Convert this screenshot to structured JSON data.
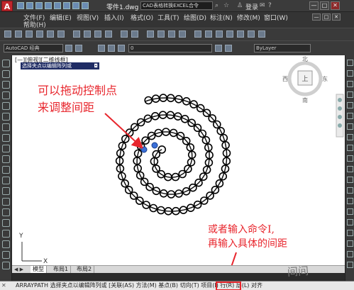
{
  "titlebar": {
    "logo": "A",
    "file_title": "零件1.dwg",
    "search_text": "CAD表格转换EXCEL合令",
    "login": "登录",
    "min_label": "—",
    "restore_label": "□",
    "close_label": "✕"
  },
  "menu": {
    "row1": [
      "文件(F)",
      "编辑(E)",
      "视图(V)",
      "插入(I)",
      "格式(O)",
      "工具(T)",
      "绘图(D)",
      "标注(N)",
      "修改(M)",
      "窗口(W)"
    ],
    "row2": [
      "帮助(H)"
    ]
  },
  "toolbar": {
    "workspace": "AutoCAD 经典",
    "layer": "0",
    "bylayer": "ByLayer"
  },
  "viewport": {
    "label": "[—][俯视][二维线框]",
    "tooltip": "选择夹点以编辑阵列或",
    "tooltip_mark": "◘"
  },
  "viewcube": {
    "north": "北",
    "south": "南",
    "east": "东",
    "west": "西",
    "top": "上",
    "wcs": "WCS"
  },
  "annotations": {
    "note1_line1": "可以拖动控制点",
    "note1_line2": "来调整间距",
    "note2_line1": "或者输入命令I,",
    "note2_line2": "再输入具体的间距"
  },
  "ucs": {
    "y_label": "Y",
    "x_label": "X"
  },
  "tabs": {
    "nav": "◀ ▶",
    "items": [
      "模型",
      "布局1",
      "布局2"
    ]
  },
  "command": {
    "close": "✕",
    "text": "ARRAYPATH 选择夹点以编辑阵列或 [关联(AS) 方法(M) 基点(B) 切向(T) 项目(I) 行(R) 层(L) 对齐"
  },
  "watermark": "间间"
}
